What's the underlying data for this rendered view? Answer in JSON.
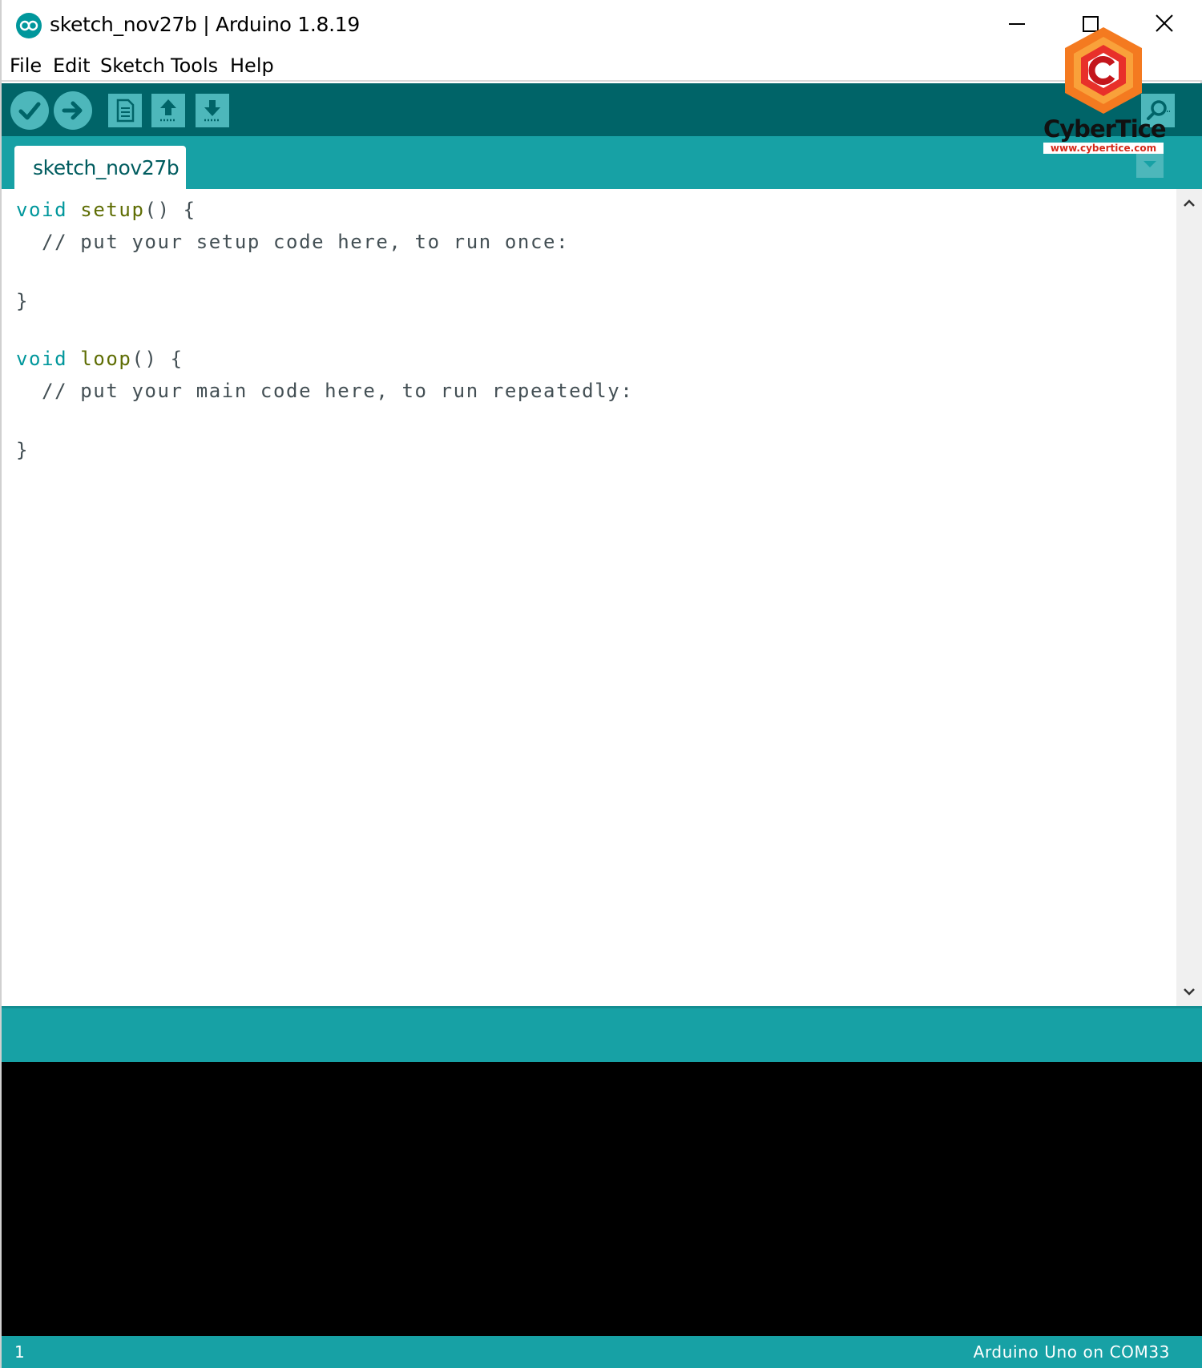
{
  "window": {
    "title": "sketch_nov27b | Arduino 1.8.19",
    "icon": "arduino-logo-icon",
    "controls": [
      "minimize-icon",
      "maximize-icon",
      "close-icon"
    ]
  },
  "menu": {
    "file": "File",
    "edit": "Edit",
    "sketch": "Sketch",
    "tools": "Tools",
    "help": "Help"
  },
  "toolbar": {
    "buttons": [
      {
        "name": "verify",
        "icon": "checkmark-icon"
      },
      {
        "name": "upload",
        "icon": "arrow-right-icon"
      },
      {
        "name": "new",
        "icon": "new-file-icon"
      },
      {
        "name": "open",
        "icon": "arrow-up-icon"
      },
      {
        "name": "save",
        "icon": "arrow-down-icon"
      },
      {
        "name": "serial-monitor",
        "icon": "magnifier-icon"
      }
    ]
  },
  "tabs": [
    {
      "label": "sketch_nov27b",
      "active": true
    }
  ],
  "editor": {
    "lines": [
      {
        "kw": "void",
        "fn": "setup",
        "rest": "() {"
      },
      {
        "comment": "  // put your setup code here, to run once:"
      },
      {
        "text": ""
      },
      {
        "text": "}"
      },
      {
        "text": ""
      },
      {
        "kw": "void",
        "fn": "loop",
        "rest": "() {"
      },
      {
        "comment": "  // put your main code here, to run repeatedly:"
      },
      {
        "text": ""
      },
      {
        "text": "}"
      }
    ]
  },
  "status": {
    "line_number": "1",
    "board": "Arduino Uno on COM33"
  },
  "watermark": {
    "name": "CyberTice",
    "url": "www.cybertice.com"
  },
  "colors": {
    "toolbar_dark": "#006468",
    "teal": "#17a1a5",
    "button": "#4db7bb",
    "keyword": "#00979c",
    "function": "#5e6d03",
    "console": "#000000"
  }
}
